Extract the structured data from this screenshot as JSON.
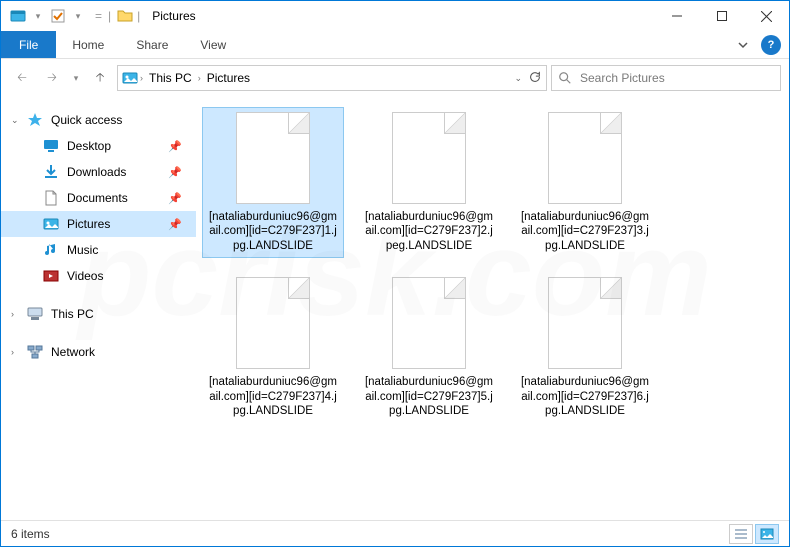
{
  "window": {
    "title": "Pictures"
  },
  "ribbon": {
    "file": "File",
    "tabs": [
      "Home",
      "Share",
      "View"
    ]
  },
  "breadcrumbs": {
    "items": [
      "This PC",
      "Pictures"
    ]
  },
  "search": {
    "placeholder": "Search Pictures"
  },
  "sidebar": {
    "quick_access": "Quick access",
    "quick_items": [
      {
        "label": "Desktop",
        "icon": "desktop"
      },
      {
        "label": "Downloads",
        "icon": "downloads"
      },
      {
        "label": "Documents",
        "icon": "documents"
      },
      {
        "label": "Pictures",
        "icon": "pictures",
        "selected": true
      },
      {
        "label": "Music",
        "icon": "music"
      },
      {
        "label": "Videos",
        "icon": "videos"
      }
    ],
    "this_pc": "This PC",
    "network": "Network"
  },
  "files": [
    {
      "name": "[nataliaburduniuc96@gmail.com][id=C279F237]1.jpg.LANDSLIDE",
      "selected": true
    },
    {
      "name": "[nataliaburduniuc96@gmail.com][id=C279F237]2.jpeg.LANDSLIDE"
    },
    {
      "name": "[nataliaburduniuc96@gmail.com][id=C279F237]3.jpg.LANDSLIDE"
    },
    {
      "name": "[nataliaburduniuc96@gmail.com][id=C279F237]4.jpg.LANDSLIDE"
    },
    {
      "name": "[nataliaburduniuc96@gmail.com][id=C279F237]5.jpg.LANDSLIDE"
    },
    {
      "name": "[nataliaburduniuc96@gmail.com][id=C279F237]6.jpg.LANDSLIDE"
    }
  ],
  "status": {
    "count_label": "6 items"
  }
}
